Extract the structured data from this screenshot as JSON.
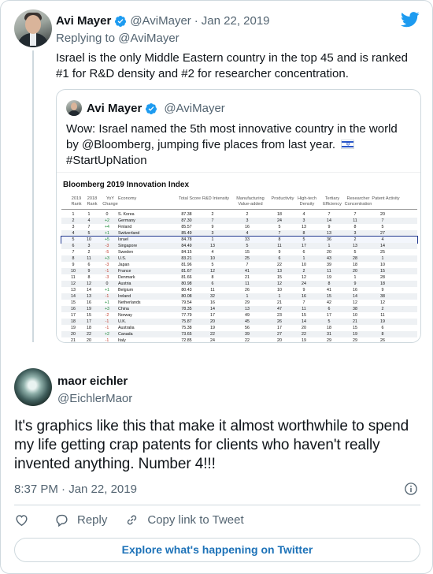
{
  "reply_tweet": {
    "author_name": "Avi Mayer",
    "author_handle": "@AviMayer",
    "date": "Jan 22, 2019",
    "replying_to": "Replying to @AviMayer",
    "text": "Israel is the only Middle Eastern country in the top 45 and is ranked #1 for R&D density and #2 for researcher concentration."
  },
  "quoted_tweet": {
    "author_name": "Avi Mayer",
    "author_handle": "@AviMayer",
    "text": "Wow: Israel named the 5th most innovative country in the world by @Bloomberg, jumping five places from last year.",
    "hashtag": "#StartUpNation"
  },
  "table": {
    "title": "Bloomberg 2019 Innovation Index",
    "headers": [
      "2019 Rank",
      "2018 Rank",
      "YoY Change",
      "Economy",
      "Total Score",
      "R&D Intensity",
      "Manufacturing Value-added",
      "Productivity",
      "High-tech Density",
      "Tertiary Efficiency",
      "Researcher Concentration",
      "Patent Activity"
    ],
    "highlight_row": 4,
    "rows": [
      [
        "1",
        "1",
        "0",
        "S. Korea",
        "87.38",
        "2",
        "2",
        "18",
        "4",
        "7",
        "7",
        "20"
      ],
      [
        "2",
        "4",
        "+2",
        "Germany",
        "87.30",
        "7",
        "3",
        "24",
        "3",
        "14",
        "11",
        "7"
      ],
      [
        "3",
        "7",
        "+4",
        "Finland",
        "85.57",
        "9",
        "16",
        "5",
        "13",
        "9",
        "8",
        "5"
      ],
      [
        "4",
        "5",
        "+1",
        "Switzerland",
        "85.49",
        "3",
        "4",
        "7",
        "8",
        "13",
        "3",
        "27"
      ],
      [
        "5",
        "10",
        "+5",
        "Israel",
        "84.78",
        "1",
        "33",
        "8",
        "5",
        "36",
        "2",
        "4"
      ],
      [
        "6",
        "3",
        "-3",
        "Singapore",
        "84.49",
        "13",
        "5",
        "11",
        "17",
        "1",
        "13",
        "14"
      ],
      [
        "7",
        "2",
        "-5",
        "Sweden",
        "84.15",
        "4",
        "15",
        "9",
        "6",
        "20",
        "5",
        "25"
      ],
      [
        "8",
        "11",
        "+3",
        "U.S.",
        "83.21",
        "10",
        "25",
        "6",
        "1",
        "43",
        "28",
        "1"
      ],
      [
        "9",
        "6",
        "-3",
        "Japan",
        "81.96",
        "5",
        "7",
        "22",
        "10",
        "39",
        "18",
        "10"
      ],
      [
        "10",
        "9",
        "-1",
        "France",
        "81.67",
        "12",
        "41",
        "13",
        "2",
        "11",
        "20",
        "15"
      ],
      [
        "11",
        "8",
        "-3",
        "Denmark",
        "81.66",
        "8",
        "21",
        "15",
        "12",
        "19",
        "1",
        "28"
      ],
      [
        "12",
        "12",
        "0",
        "Austria",
        "80.98",
        "6",
        "11",
        "12",
        "24",
        "8",
        "9",
        "18"
      ],
      [
        "13",
        "14",
        "+1",
        "Belgium",
        "80.43",
        "11",
        "26",
        "10",
        "9",
        "41",
        "16",
        "9"
      ],
      [
        "14",
        "13",
        "-1",
        "Ireland",
        "80.08",
        "32",
        "1",
        "1",
        "16",
        "15",
        "14",
        "38"
      ],
      [
        "15",
        "16",
        "+1",
        "Netherlands",
        "79.54",
        "16",
        "29",
        "21",
        "7",
        "42",
        "12",
        "12"
      ],
      [
        "16",
        "19",
        "+3",
        "China",
        "78.35",
        "14",
        "13",
        "47",
        "11",
        "6",
        "38",
        "2"
      ],
      [
        "17",
        "15",
        "-2",
        "Norway",
        "77.79",
        "17",
        "49",
        "23",
        "15",
        "17",
        "10",
        "11"
      ],
      [
        "18",
        "17",
        "-1",
        "U.K.",
        "75.87",
        "20",
        "45",
        "26",
        "14",
        "5",
        "21",
        "19"
      ],
      [
        "19",
        "18",
        "-1",
        "Australia",
        "75.38",
        "19",
        "56",
        "17",
        "20",
        "18",
        "15",
        "6"
      ],
      [
        "20",
        "22",
        "+2",
        "Canada",
        "73.65",
        "22",
        "39",
        "27",
        "22",
        "31",
        "19",
        "8"
      ],
      [
        "21",
        "20",
        "-1",
        "Italy",
        "72.85",
        "24",
        "22",
        "20",
        "19",
        "29",
        "29",
        "26"
      ],
      [
        "22",
        "21",
        "-1",
        "Poland",
        "69.10",
        "36",
        "20",
        "40",
        "18",
        "16",
        "38",
        "37"
      ]
    ]
  },
  "main_tweet": {
    "author_name": "maor eichler",
    "author_handle": "@EichlerMaor",
    "text": "It's graphics like this that make it almost worthwhile to spend my life getting crap patents for clients who haven't really invented anything. Number 4!!!",
    "timestamp": "8:37 PM · Jan 22, 2019"
  },
  "actions": {
    "reply_label": "Reply",
    "copy_link_label": "Copy link to Tweet",
    "explore_label": "Explore what's happening on Twitter"
  },
  "icons": {
    "brand": "twitter-bird-icon",
    "verified": "verified-badge-icon",
    "info": "info-icon",
    "like": "heart-icon",
    "reply": "reply-icon",
    "copy_link": "link-icon"
  },
  "colors": {
    "twitter_blue": "#1d9bf0",
    "link_blue": "#1d72b8",
    "muted_text": "#536471",
    "border": "#cfd9de",
    "highlight_outline": "#233a8f"
  }
}
